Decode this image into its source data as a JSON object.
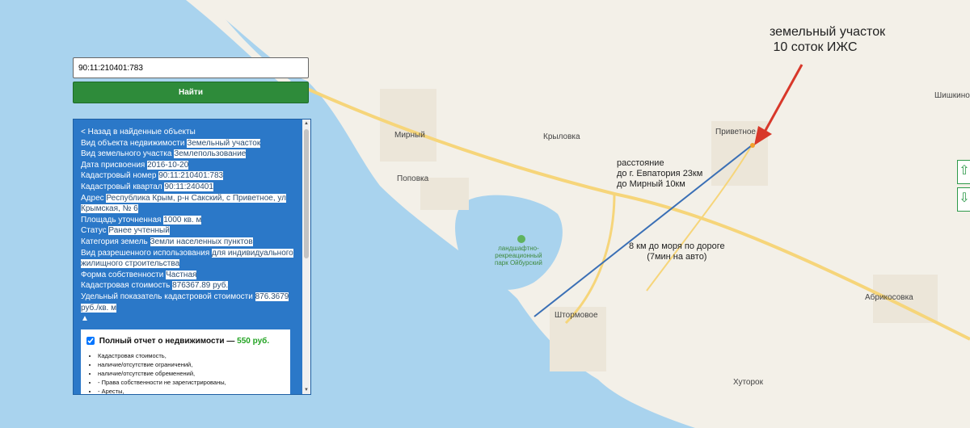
{
  "search": {
    "value": "90:11:210401:783",
    "button_label": "Найти"
  },
  "info": {
    "back_link": "< Назад в найденные объекты",
    "rows": [
      {
        "label": "Вид объекта недвижимости",
        "value": "Земельный участок"
      },
      {
        "label": "Вид земельного участка",
        "value": "Землепользование"
      },
      {
        "label": "Дата присвоения",
        "value": "2016-10-20"
      },
      {
        "label": "Кадастровый номер",
        "value": "90:11:210401:783"
      },
      {
        "label": "Кадастровый квартал",
        "value": "90:11:240401"
      },
      {
        "label": "Адрес",
        "value": "Республика Крым, р-н Сакский, с Приветное, ул Крымская, № 6"
      },
      {
        "label": "Площадь уточненная",
        "value": "1000 кв. м"
      },
      {
        "label": "Статус",
        "value": "Ранее учтенный"
      },
      {
        "label": "Категория земель",
        "value": "Земли населенных пунктов"
      },
      {
        "label": "Вид разрешенного использования",
        "value": "для индивидуального жилищного строительства"
      },
      {
        "label": "Форма собственности",
        "value": "Частная"
      },
      {
        "label": "Кадастровая стоимость",
        "value": "876367.89 руб."
      },
      {
        "label": "Удельный показатель кадастровой стоимости",
        "value": "876.3679 руб./кв. м"
      }
    ],
    "collapse": "▲",
    "report": {
      "title": "Полный отчет о недвижимости —",
      "price": "550 руб.",
      "items": [
        "Кадастровая стоимость,",
        "наличие/отсутствие ограничений,",
        "наличие/отсутствие обременений,",
        "- Права собственности не зарегистрированы,",
        "- Аресты,"
      ]
    }
  },
  "map": {
    "places": {
      "mirny": "Мирный",
      "krylovka": "Крыловка",
      "privetnoe": "Приветное",
      "shishkino": "Шишкино",
      "popovka": "Поповка",
      "park": "ландшафтно-\nрекреационный\nпарк Ойбурский",
      "stormovoe": "Штормовое",
      "abrikosovka": "Абрикосовка",
      "khutorok": "Хуторок"
    },
    "annotations": {
      "plot": "земельный участок\n 10 соток ИЖС",
      "distance": "расстояние\nдо г. Евпатория 23км\nдо Мирный 10км",
      "sea": "8 км до моря по дороге\n(7мин на авто)"
    },
    "colors": {
      "water": "#a9d3ee",
      "land": "#f3f0e8",
      "road": "#f6d57a",
      "line": "#3a6fb5",
      "arrow": "#d8382a"
    },
    "icons": {
      "zoom_up": "arrow-up-icon",
      "zoom_down": "arrow-down-icon"
    }
  }
}
